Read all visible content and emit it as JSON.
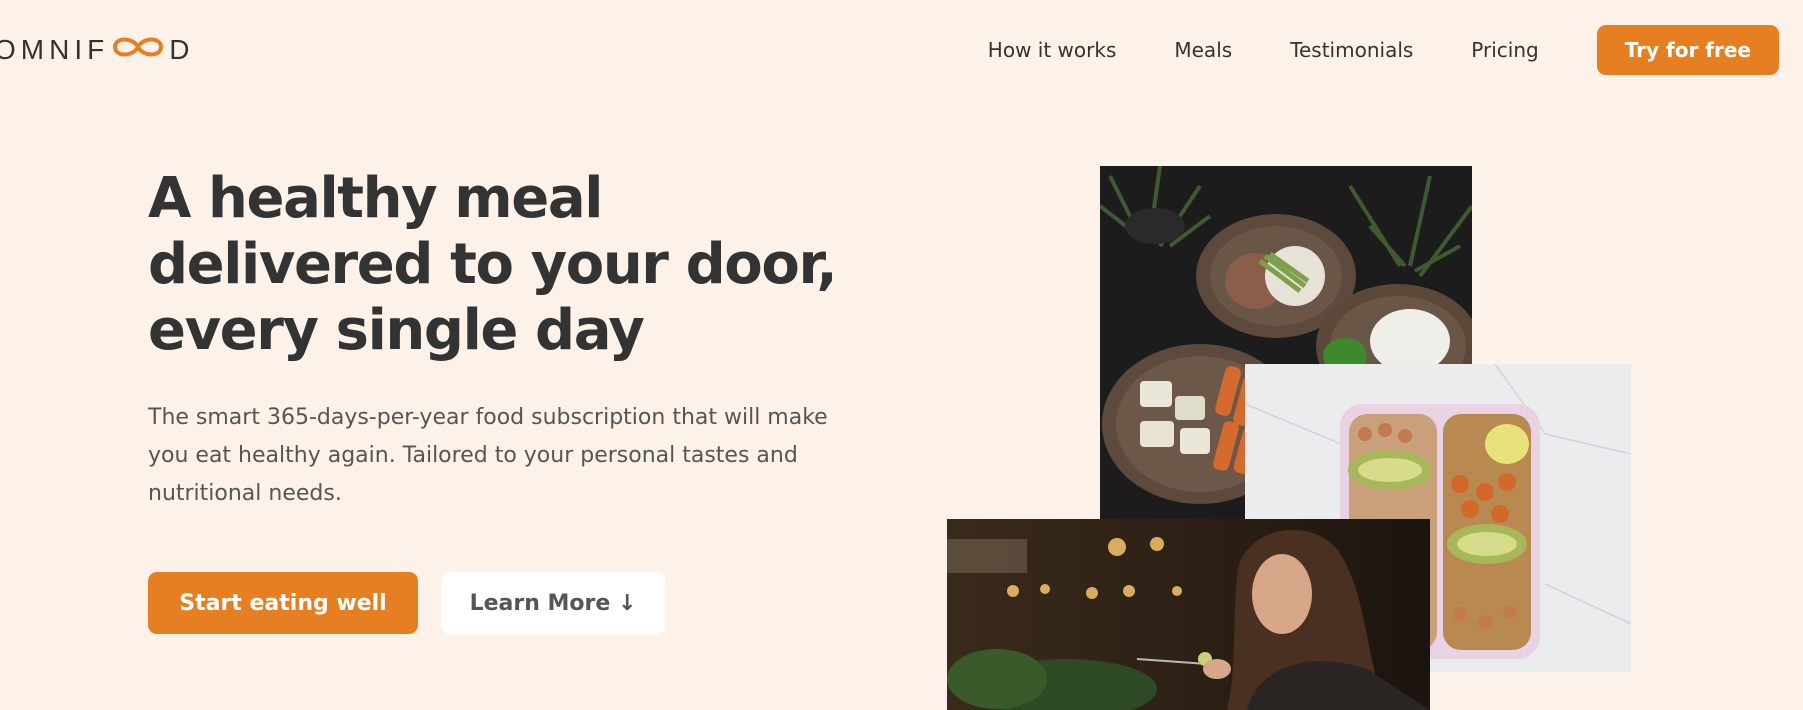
{
  "header": {
    "logo": {
      "text_before": "OMNIF",
      "text_after": "D",
      "icon": "infinity-icon"
    },
    "nav": [
      {
        "label": "How it works"
      },
      {
        "label": "Meals"
      },
      {
        "label": "Testimonials"
      },
      {
        "label": "Pricing"
      }
    ],
    "cta_label": "Try for free"
  },
  "hero": {
    "title": "A healthy meal delivered to your door, every single day",
    "description": "The smart 365-days-per-year food subscription that will make you eat healthy again. Tailored to your personal tastes and nutritional needs.",
    "primary_button": "Start eating well",
    "secondary_button": "Learn More ↓",
    "images": [
      {
        "name": "bowls-photo",
        "subject": "three bowls of rice, noodles and vegetables on dark table with plants"
      },
      {
        "name": "meal-prep-photo",
        "subject": "meal prep containers with chickpeas, avocado and grains on marble"
      },
      {
        "name": "woman-eating-photo",
        "subject": "woman eating salad in a restaurant"
      }
    ]
  },
  "colors": {
    "background": "#fdf2e9",
    "accent": "#e67e22",
    "text_dark": "#333333",
    "text_body": "#555555",
    "white": "#ffffff"
  }
}
